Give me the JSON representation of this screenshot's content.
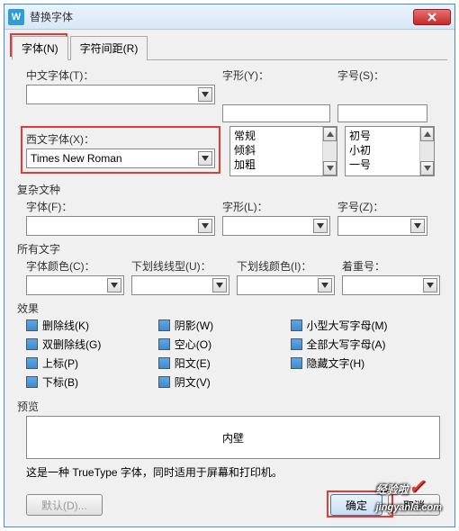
{
  "window": {
    "app_icon": "W",
    "title": "替换字体",
    "close": "×"
  },
  "tabs": {
    "font": "字体(N)",
    "spacing": "字符间距(R)"
  },
  "labels": {
    "cjk_font": "中文字体(T)：",
    "style": "字形(Y)：",
    "size": "字号(S)：",
    "western_font": "西文字体(X)：",
    "style2": "字形(L)：",
    "size2": "字号(Z)：",
    "font2": "字体(F)：",
    "font_color": "字体颜色(C)：",
    "underline_type": "下划线线型(U)：",
    "underline_color": "下划线颜色(I)：",
    "emphasis": "着重号：",
    "complex": "复杂文种",
    "all_text": "所有文字",
    "effects": "效果",
    "preview": "预览"
  },
  "values": {
    "cjk_font": "",
    "western_font": "Times New Roman",
    "font2": "",
    "style2": "",
    "size2": ""
  },
  "style_list": [
    "常规",
    "倾斜",
    "加粗"
  ],
  "size_list": [
    "初号",
    "小初",
    "一号"
  ],
  "effects": {
    "strike": "删除线(K)",
    "dstrike": "双删除线(G)",
    "super": "上标(P)",
    "sub": "下标(B)",
    "shadow": "阴影(W)",
    "outline": "空心(O)",
    "emboss": "阳文(E)",
    "engrave": "阴文(V)",
    "smallcaps": "小型大写字母(M)",
    "allcaps": "全部大写字母(A)",
    "hidden": "隐藏文字(H)"
  },
  "preview_text": "内壁",
  "footnote": "这是一种 TrueType 字体，同时适用于屏幕和打印机。",
  "footer": {
    "default": "默认(D)...",
    "ok": "确定",
    "cancel": "取消"
  },
  "watermark": {
    "brand": "经验啦",
    "domain": "jingyanla.com"
  }
}
